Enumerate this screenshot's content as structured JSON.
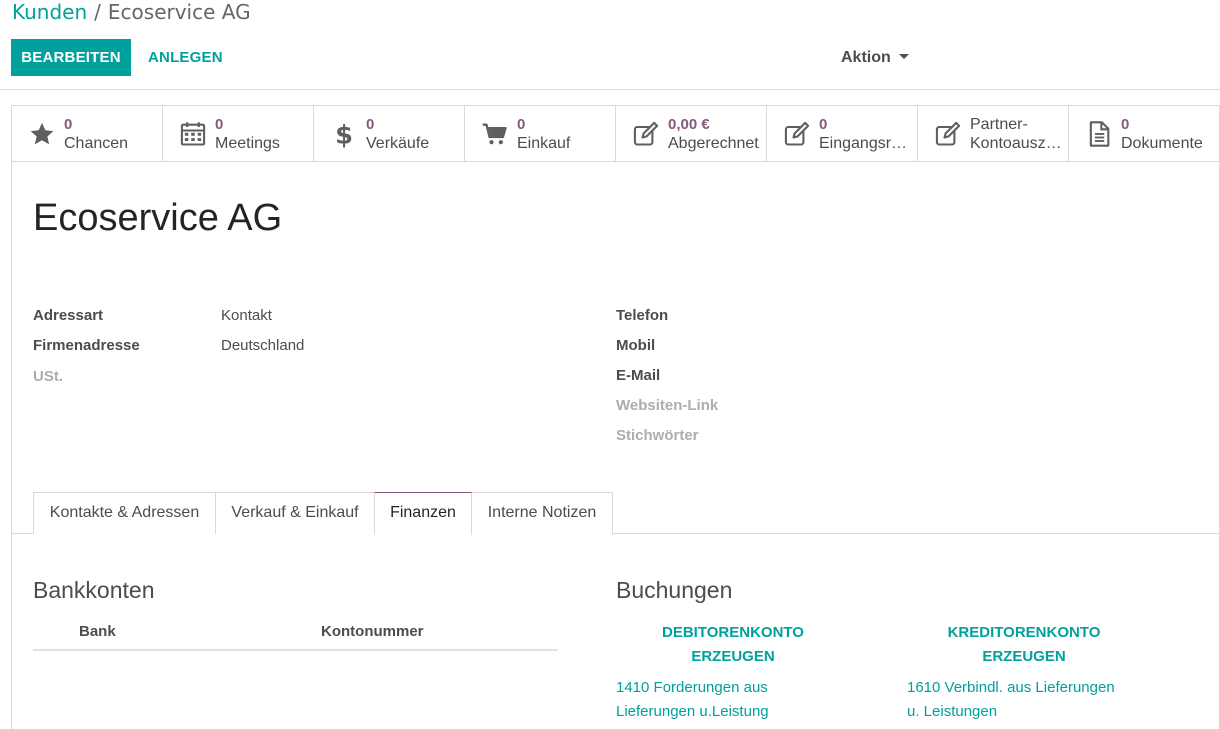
{
  "breadcrumb": {
    "parent": "Kunden",
    "separator": "/",
    "current": "Ecoservice AG"
  },
  "toolbar": {
    "edit_label": "BEARBEITEN",
    "create_label": "ANLEGEN",
    "action_label": "Aktion"
  },
  "stat_buttons": [
    {
      "icon": "star-icon",
      "value": "0",
      "label": "Chancen"
    },
    {
      "icon": "calendar-icon",
      "value": "0",
      "label": "Meetings"
    },
    {
      "icon": "dollar-icon",
      "value": "0",
      "label": "Verkäufe"
    },
    {
      "icon": "shopping-cart-icon",
      "value": "0",
      "label": "Einkauf"
    },
    {
      "icon": "edit-icon",
      "value": "0,00 €",
      "label": "Abgerechnet"
    },
    {
      "icon": "edit-icon",
      "value": "0",
      "label": "Eingangsrechnungen"
    },
    {
      "icon": "edit-icon",
      "value": "Partner-",
      "label": "Kontoauszug"
    },
    {
      "icon": "document-icon",
      "value": "0",
      "label": "Dokumente"
    }
  ],
  "record": {
    "name": "Ecoservice AG"
  },
  "fields_left": [
    {
      "label": "Adressart",
      "value": "Kontakt"
    },
    {
      "label": "Firmenadresse",
      "value": "Deutschland"
    },
    {
      "label": "USt.",
      "value": ""
    }
  ],
  "fields_right": [
    {
      "label": "Telefon"
    },
    {
      "label": "Mobil"
    },
    {
      "label": "E-Mail"
    },
    {
      "label": "Websiten-Link"
    },
    {
      "label": "Stichwörter"
    }
  ],
  "tabs": [
    {
      "label": "Kontakte & Adressen"
    },
    {
      "label": "Verkauf & Einkauf"
    },
    {
      "label": "Finanzen",
      "active": true
    },
    {
      "label": "Interne Notizen"
    }
  ],
  "bank": {
    "title": "Bankkonten",
    "columns": [
      "Bank",
      "Kontonummer"
    ]
  },
  "bookings": {
    "title": "Buchungen",
    "debitor_button": [
      "DEBITORENKONTO",
      "ERZEUGEN"
    ],
    "debitor_account": [
      "1410 Forderungen aus",
      "Lieferungen u.Leistung"
    ],
    "kreditor_button": [
      "KREDITORENKONTO",
      "ERZEUGEN"
    ],
    "kreditor_account": [
      "1610 Verbindl. aus Lieferungen",
      "u. Leistungen"
    ]
  },
  "colors": {
    "primary": "#00a09d",
    "accent": "#875a7b"
  }
}
